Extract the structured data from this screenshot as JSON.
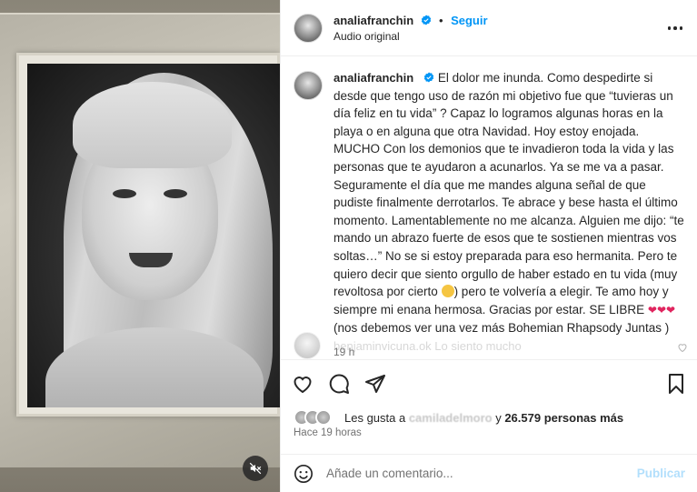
{
  "header": {
    "username": "analiafranchin",
    "follow_label": "Seguir",
    "subtitle": "Audio original"
  },
  "caption": {
    "username": "analiafranchin",
    "text_1": "El dolor me inunda. Como despedirte si desde que tengo uso de razón mi objetivo fue que “tuvieras un día feliz en tu vida” ? Capaz lo logramos algunas horas en la playa o en alguna que otra Navidad. Hoy estoy enojada. MUCHO Con los demonios que te invadieron toda la vida y las personas que te ayudaron a acunarlos. Ya se me va a pasar. Seguramente el día que me mandes alguna señal de que pudiste finalmente derrotarlos. Te abrace y bese hasta el último momento. Lamentablemente no me alcanza. Alguien me dijo: “te mando un abrazo fuerte de esos que te sostienen mientras vos soltas…” No se si estoy preparada para eso hermanita. Pero te quiero decir que siento orgullo de haber estado en tu vida (muy revoltosa por cierto ",
    "text_2": ") pero te volvería a elegir. Te amo hoy y siempre mi enana hermosa. Gracias por estar. SE LIBRE ",
    "hearts": "❤❤❤",
    "text_3": " (nos debemos ver una vez más Bohemian Rhapsody Juntas )",
    "time": "19 h"
  },
  "faded_comment": {
    "text": "benjaminvicuna.ok  Lo siento mucho"
  },
  "likes": {
    "prefix": "Les gusta a ",
    "blurred_name": "camiladelmoro",
    "middle": " y ",
    "count": "26.579 personas más"
  },
  "posted_ago": "Hace 19 horas",
  "comment_box": {
    "placeholder": "Añade un comentario...",
    "publish_label": "Publicar"
  },
  "colors": {
    "accent": "#0095f6",
    "publish_disabled": "#b2dffc",
    "heart": "#e0245e"
  },
  "icons": [
    "verified-badge-icon",
    "more-options-icon",
    "heart-icon",
    "comment-icon",
    "share-icon",
    "bookmark-icon",
    "emoji-icon",
    "mute-icon"
  ]
}
